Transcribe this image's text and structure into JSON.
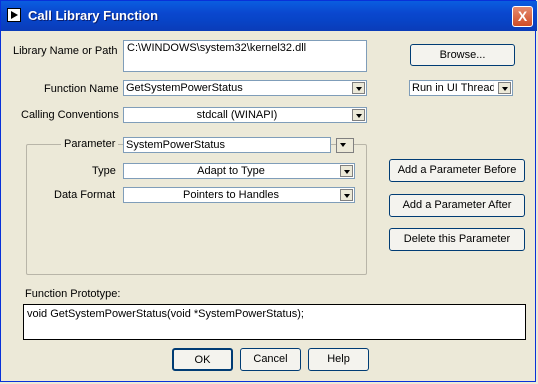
{
  "window": {
    "title": "Call Library Function",
    "close_label": "X"
  },
  "library": {
    "label": "Library Name or Path",
    "value": "C:\\WINDOWS\\system32\\kernel32.dll",
    "browse_label": "Browse..."
  },
  "function": {
    "label": "Function Name",
    "value": "GetSystemPowerStatus"
  },
  "thread": {
    "value": "Run in UI Thread"
  },
  "calling": {
    "label": "Calling Conventions",
    "value": "stdcall (WINAPI)"
  },
  "parameter": {
    "label": "Parameter",
    "value": "SystemPowerStatus"
  },
  "type": {
    "label": "Type",
    "value": "Adapt to Type"
  },
  "data_format": {
    "label": "Data Format",
    "value": "Pointers to Handles"
  },
  "param_buttons": {
    "before": "Add a Parameter Before",
    "after": "Add a Parameter After",
    "delete": "Delete this Parameter"
  },
  "prototype": {
    "label": "Function Prototype:",
    "value": "void GetSystemPowerStatus(void *SystemPowerStatus);"
  },
  "footer": {
    "ok": "OK",
    "cancel": "Cancel",
    "help": "Help"
  }
}
